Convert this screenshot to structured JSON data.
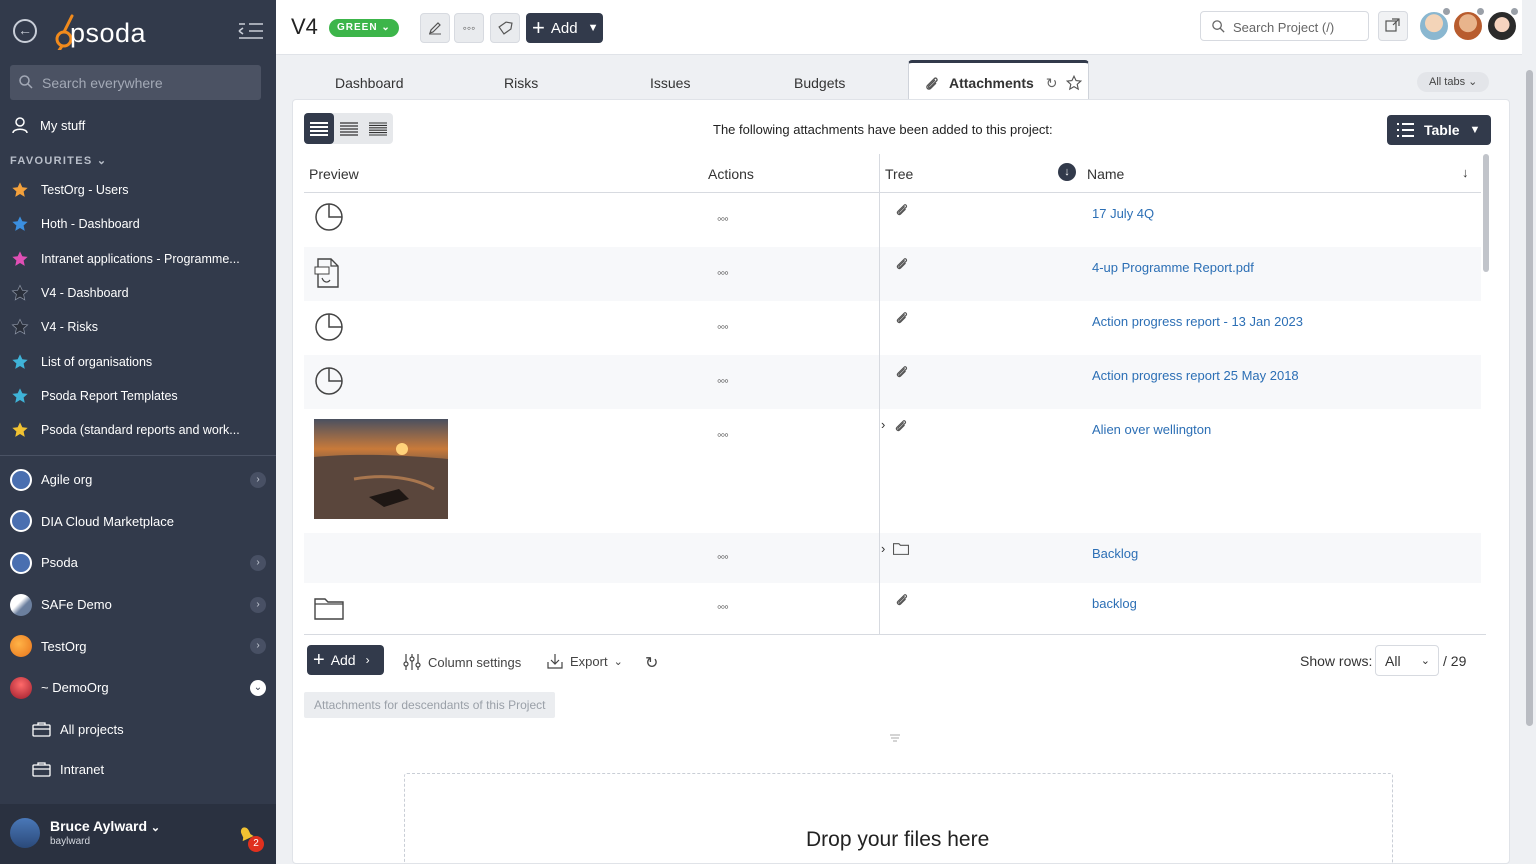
{
  "app": {
    "logo_text": "psoda",
    "search_placeholder": "Search everywhere",
    "my_stuff": "My stuff",
    "favourites_header": "FAVOURITES"
  },
  "favourites": [
    {
      "label": "TestOrg - Users",
      "color": "#f4a13c"
    },
    {
      "label": "Hoth - Dashboard",
      "color": "#3b8fe0"
    },
    {
      "label": "Intranet applications - Programme...",
      "color": "#e04fb5"
    },
    {
      "label": "V4 - Dashboard",
      "color": "#2a2f3a"
    },
    {
      "label": "V4 - Risks",
      "color": "#2a2f3a"
    },
    {
      "label": "List of organisations",
      "color": "#3fb3d8"
    },
    {
      "label": "Psoda Report Templates",
      "color": "#3fb3d8"
    },
    {
      "label": "Psoda (standard reports and work...",
      "color": "#f1c232"
    }
  ],
  "orgs": [
    {
      "label": "Agile org",
      "chevron": true
    },
    {
      "label": "DIA Cloud Marketplace",
      "chevron": false
    },
    {
      "label": "Psoda",
      "chevron": true
    },
    {
      "label": "SAFe Demo",
      "chevron": true
    },
    {
      "label": "TestOrg",
      "chevron": true
    },
    {
      "label": "~ DemoOrg",
      "chevron": true
    }
  ],
  "sub_items": [
    {
      "label": "All projects"
    },
    {
      "label": "Intranet"
    }
  ],
  "user": {
    "name": "Bruce Aylward",
    "login": "baylward",
    "notifications": "2"
  },
  "project": {
    "title": "V4",
    "status": "GREEN",
    "add_label": "Add",
    "search_placeholder": "Search Project (/)"
  },
  "tabs": [
    {
      "label": "Dashboard"
    },
    {
      "label": "Risks"
    },
    {
      "label": "Issues"
    },
    {
      "label": "Budgets"
    }
  ],
  "active_tab": {
    "label": "Attachments"
  },
  "all_tabs": "All tabs",
  "panel": {
    "intro": "The following attachments have been added to this project:",
    "view_label": "Table",
    "columns": {
      "preview": "Preview",
      "actions": "Actions",
      "tree": "Tree",
      "name": "Name"
    }
  },
  "rows": [
    {
      "name": "17 July 4Q",
      "preview": "pie-chart-icon",
      "tree": "paperclip-icon",
      "expandable": false
    },
    {
      "name": "4-up Programme Report.pdf",
      "preview": "pdf-file-icon",
      "tree": "paperclip-icon",
      "expandable": false
    },
    {
      "name": "Action progress report - 13 Jan 2023",
      "preview": "pie-chart-icon",
      "tree": "paperclip-icon",
      "expandable": false
    },
    {
      "name": "Action progress report 25 May 2018",
      "preview": "pie-chart-icon",
      "tree": "paperclip-icon",
      "expandable": false
    },
    {
      "name": "Alien over wellington",
      "preview": "sunset-photo",
      "tree": "paperclip-icon",
      "expandable": true
    },
    {
      "name": "Backlog",
      "preview": "",
      "tree": "folder-icon",
      "expandable": true
    },
    {
      "name": "backlog",
      "preview": "folder-icon",
      "tree": "paperclip-icon",
      "expandable": false
    }
  ],
  "toolbar": {
    "add": "Add",
    "column_settings": "Column settings",
    "export": "Export",
    "show_rows_label": "Show rows:",
    "show_rows_value": "All",
    "total": "/ 29"
  },
  "descendants_tab": "Attachments for descendants of this Project",
  "dropzone": "Drop your files here"
}
